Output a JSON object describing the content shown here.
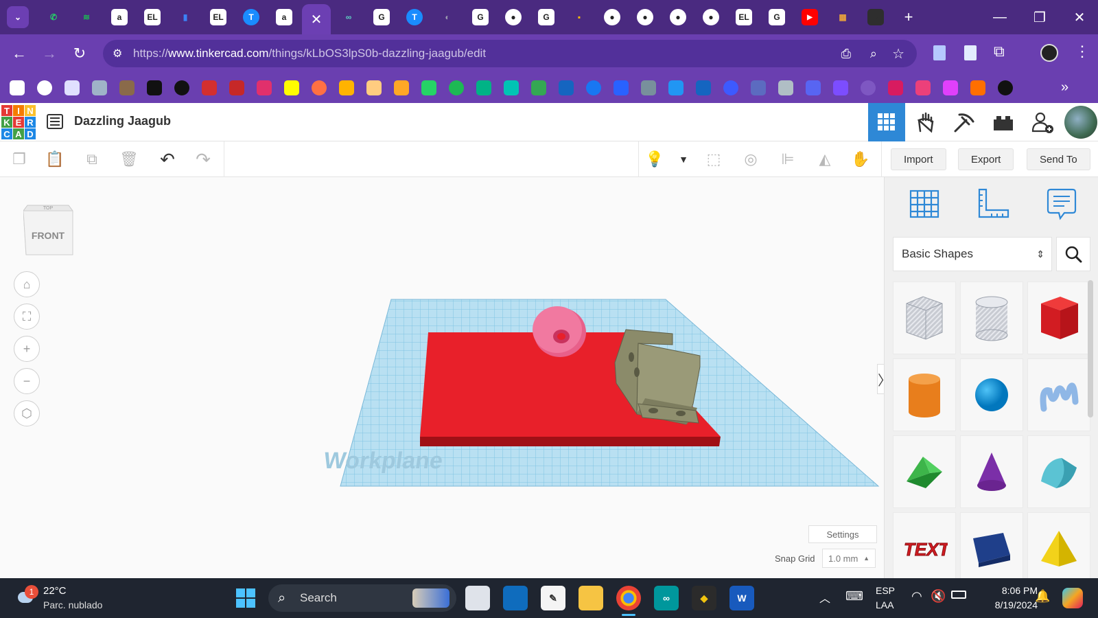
{
  "browser": {
    "tabs": [
      {
        "icon": "whatsapp-icon",
        "color": "#25d366",
        "glyph": "✆"
      },
      {
        "icon": "spotify-icon",
        "color": "#1db954",
        "glyph": "≋"
      },
      {
        "icon": "amazon-icon",
        "color": "#ffffff",
        "glyph": "a"
      },
      {
        "icon": "el-icon",
        "color": "#ffffff",
        "glyph": "EL"
      },
      {
        "icon": "bookmark-tab-icon",
        "color": "#3b82f6",
        "glyph": "▮"
      },
      {
        "icon": "el-icon",
        "color": "#ffffff",
        "glyph": "EL"
      },
      {
        "icon": "translate-icon",
        "color": "#1a8cff",
        "glyph": "T"
      },
      {
        "icon": "amazon-icon",
        "color": "#ffffff",
        "glyph": "a"
      }
    ],
    "tabs_after": [
      {
        "icon": "infinity-icon",
        "color": "#5fd3c4",
        "glyph": "∞"
      },
      {
        "icon": "google-icon",
        "color": "#ffffff",
        "glyph": "G"
      },
      {
        "icon": "translate-icon",
        "color": "#1a8cff",
        "glyph": "T"
      },
      {
        "icon": "globe-icon",
        "color": "#9c9cb0",
        "glyph": "◐"
      },
      {
        "icon": "google-icon",
        "color": "#ffffff",
        "glyph": "G"
      },
      {
        "icon": "github-icon",
        "color": "#ffffff",
        "glyph": "●"
      },
      {
        "icon": "google-icon",
        "color": "#ffffff",
        "glyph": "G"
      },
      {
        "icon": "keep-icon",
        "color": "#fbbc04",
        "glyph": "▪"
      },
      {
        "icon": "github-icon",
        "color": "#ffffff",
        "glyph": "●"
      },
      {
        "icon": "github-icon",
        "color": "#ffffff",
        "glyph": "●"
      },
      {
        "icon": "github-icon",
        "color": "#ffffff",
        "glyph": "●"
      },
      {
        "icon": "github-icon",
        "color": "#ffffff",
        "glyph": "●"
      },
      {
        "icon": "el-icon",
        "color": "#ffffff",
        "glyph": "EL"
      },
      {
        "icon": "google-icon",
        "color": "#ffffff",
        "glyph": "G"
      },
      {
        "icon": "youtube-icon",
        "color": "#ff0000",
        "glyph": "▶"
      },
      {
        "icon": "tinkercad-icon",
        "color": "#e9a23b",
        "glyph": "▦"
      },
      {
        "icon": "bird-icon",
        "color": "#2e2e2e",
        "glyph": "✦"
      }
    ],
    "url_prefix": "https://",
    "url_domain": "www.tinkercad.com",
    "url_path": "/things/kLbOS3lpS0b-dazzling-jaagub/edit",
    "bookmark_colors": [
      "#ffffff",
      "#ffffff",
      "#e0e0ff",
      "#9fb3c8",
      "#8a6a4a",
      "#111111",
      "#111111",
      "#d32f2f",
      "#c62828",
      "#e1306c",
      "#fffc00",
      "#ff7043",
      "#ffb300",
      "#ffcc80",
      "#ffa726",
      "#25d366",
      "#1db954",
      "#00b386",
      "#00c4b4",
      "#34a853",
      "#1565c0",
      "#1877f2",
      "#2962ff",
      "#78909c",
      "#2196f3",
      "#1565c0",
      "#3d5afe",
      "#5c6bc0",
      "#b0bec5",
      "#5865f2",
      "#7c4dff",
      "#7e57c2",
      "#d81b60",
      "#ec407a",
      "#e040fb",
      "#ff6f00",
      "#111111"
    ]
  },
  "tinkercad": {
    "logo_letters": [
      "T",
      "I",
      "N",
      "K",
      "E",
      "R",
      "C",
      "A",
      "D"
    ],
    "logo_colors": [
      "#e53935",
      "#f57c00",
      "#fbc02d",
      "#43a047",
      "#e53935",
      "#1e88e5",
      "#1e88e5",
      "#43a047",
      "#1e88e5"
    ],
    "design_title": "Dazzling Jaagub",
    "import_label": "Import",
    "export_label": "Export",
    "send_to_label": "Send To",
    "viewcube_top": "TOP",
    "viewcube_front": "FRONT",
    "workplane_label": "Workplane",
    "settings_label": "Settings",
    "snap_grid_label": "Snap Grid",
    "snap_grid_value": "1.0 mm",
    "shape_category": "Basic Shapes",
    "accent": "#2e88d6"
  },
  "taskbar": {
    "notification_count": "1",
    "temperature": "22°C",
    "weather": "Parc. nublado",
    "search_placeholder": "Search",
    "lang_primary": "ESP",
    "lang_secondary": "LAA",
    "time": "8:06 PM",
    "date": "8/19/2024"
  }
}
